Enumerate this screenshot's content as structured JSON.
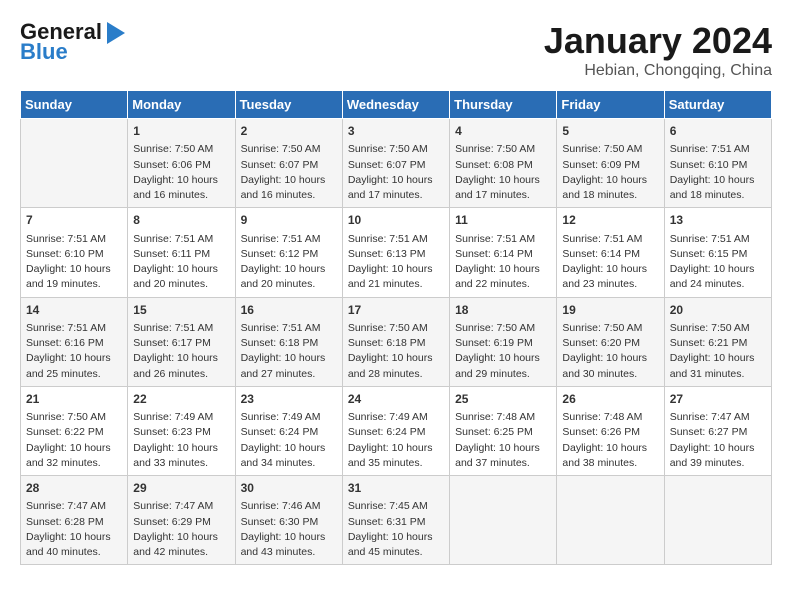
{
  "header": {
    "logo_line1": "General",
    "logo_line2": "Blue",
    "month_title": "January 2024",
    "location": "Hebian, Chongqing, China"
  },
  "days_of_week": [
    "Sunday",
    "Monday",
    "Tuesday",
    "Wednesday",
    "Thursday",
    "Friday",
    "Saturday"
  ],
  "weeks": [
    [
      {
        "day": "",
        "info": ""
      },
      {
        "day": "1",
        "info": "Sunrise: 7:50 AM\nSunset: 6:06 PM\nDaylight: 10 hours\nand 16 minutes."
      },
      {
        "day": "2",
        "info": "Sunrise: 7:50 AM\nSunset: 6:07 PM\nDaylight: 10 hours\nand 16 minutes."
      },
      {
        "day": "3",
        "info": "Sunrise: 7:50 AM\nSunset: 6:07 PM\nDaylight: 10 hours\nand 17 minutes."
      },
      {
        "day": "4",
        "info": "Sunrise: 7:50 AM\nSunset: 6:08 PM\nDaylight: 10 hours\nand 17 minutes."
      },
      {
        "day": "5",
        "info": "Sunrise: 7:50 AM\nSunset: 6:09 PM\nDaylight: 10 hours\nand 18 minutes."
      },
      {
        "day": "6",
        "info": "Sunrise: 7:51 AM\nSunset: 6:10 PM\nDaylight: 10 hours\nand 18 minutes."
      }
    ],
    [
      {
        "day": "7",
        "info": "Sunrise: 7:51 AM\nSunset: 6:10 PM\nDaylight: 10 hours\nand 19 minutes."
      },
      {
        "day": "8",
        "info": "Sunrise: 7:51 AM\nSunset: 6:11 PM\nDaylight: 10 hours\nand 20 minutes."
      },
      {
        "day": "9",
        "info": "Sunrise: 7:51 AM\nSunset: 6:12 PM\nDaylight: 10 hours\nand 20 minutes."
      },
      {
        "day": "10",
        "info": "Sunrise: 7:51 AM\nSunset: 6:13 PM\nDaylight: 10 hours\nand 21 minutes."
      },
      {
        "day": "11",
        "info": "Sunrise: 7:51 AM\nSunset: 6:14 PM\nDaylight: 10 hours\nand 22 minutes."
      },
      {
        "day": "12",
        "info": "Sunrise: 7:51 AM\nSunset: 6:14 PM\nDaylight: 10 hours\nand 23 minutes."
      },
      {
        "day": "13",
        "info": "Sunrise: 7:51 AM\nSunset: 6:15 PM\nDaylight: 10 hours\nand 24 minutes."
      }
    ],
    [
      {
        "day": "14",
        "info": "Sunrise: 7:51 AM\nSunset: 6:16 PM\nDaylight: 10 hours\nand 25 minutes."
      },
      {
        "day": "15",
        "info": "Sunrise: 7:51 AM\nSunset: 6:17 PM\nDaylight: 10 hours\nand 26 minutes."
      },
      {
        "day": "16",
        "info": "Sunrise: 7:51 AM\nSunset: 6:18 PM\nDaylight: 10 hours\nand 27 minutes."
      },
      {
        "day": "17",
        "info": "Sunrise: 7:50 AM\nSunset: 6:18 PM\nDaylight: 10 hours\nand 28 minutes."
      },
      {
        "day": "18",
        "info": "Sunrise: 7:50 AM\nSunset: 6:19 PM\nDaylight: 10 hours\nand 29 minutes."
      },
      {
        "day": "19",
        "info": "Sunrise: 7:50 AM\nSunset: 6:20 PM\nDaylight: 10 hours\nand 30 minutes."
      },
      {
        "day": "20",
        "info": "Sunrise: 7:50 AM\nSunset: 6:21 PM\nDaylight: 10 hours\nand 31 minutes."
      }
    ],
    [
      {
        "day": "21",
        "info": "Sunrise: 7:50 AM\nSunset: 6:22 PM\nDaylight: 10 hours\nand 32 minutes."
      },
      {
        "day": "22",
        "info": "Sunrise: 7:49 AM\nSunset: 6:23 PM\nDaylight: 10 hours\nand 33 minutes."
      },
      {
        "day": "23",
        "info": "Sunrise: 7:49 AM\nSunset: 6:24 PM\nDaylight: 10 hours\nand 34 minutes."
      },
      {
        "day": "24",
        "info": "Sunrise: 7:49 AM\nSunset: 6:24 PM\nDaylight: 10 hours\nand 35 minutes."
      },
      {
        "day": "25",
        "info": "Sunrise: 7:48 AM\nSunset: 6:25 PM\nDaylight: 10 hours\nand 37 minutes."
      },
      {
        "day": "26",
        "info": "Sunrise: 7:48 AM\nSunset: 6:26 PM\nDaylight: 10 hours\nand 38 minutes."
      },
      {
        "day": "27",
        "info": "Sunrise: 7:47 AM\nSunset: 6:27 PM\nDaylight: 10 hours\nand 39 minutes."
      }
    ],
    [
      {
        "day": "28",
        "info": "Sunrise: 7:47 AM\nSunset: 6:28 PM\nDaylight: 10 hours\nand 40 minutes."
      },
      {
        "day": "29",
        "info": "Sunrise: 7:47 AM\nSunset: 6:29 PM\nDaylight: 10 hours\nand 42 minutes."
      },
      {
        "day": "30",
        "info": "Sunrise: 7:46 AM\nSunset: 6:30 PM\nDaylight: 10 hours\nand 43 minutes."
      },
      {
        "day": "31",
        "info": "Sunrise: 7:45 AM\nSunset: 6:31 PM\nDaylight: 10 hours\nand 45 minutes."
      },
      {
        "day": "",
        "info": ""
      },
      {
        "day": "",
        "info": ""
      },
      {
        "day": "",
        "info": ""
      }
    ]
  ]
}
